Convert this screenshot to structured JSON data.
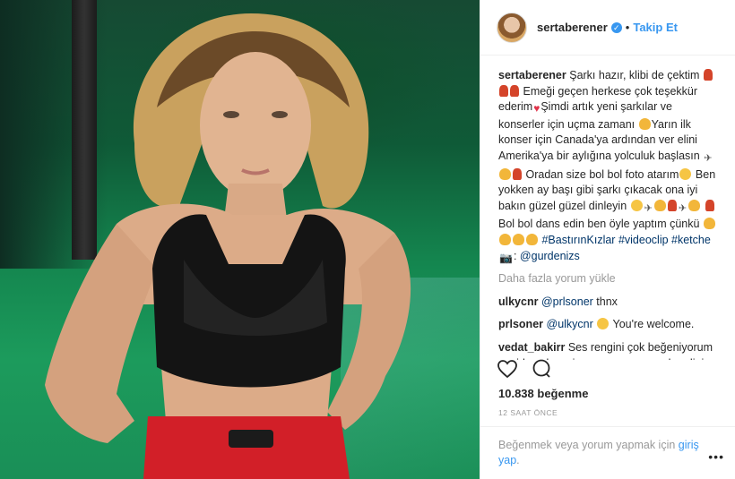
{
  "post": {
    "username": "sertaberener",
    "follow_label": "Takip Et",
    "separator": "•",
    "caption_parts": {
      "p1": "Şarkı hazır, klibi de çektim",
      "p2": "Emeği geçen herkese çok teşekkür ederim",
      "p3": "Şimdi artık yeni şarkılar ve konserler için uçma zamanı",
      "p4": "Yarın ilk konser için Canada'ya ardından ver elini Amerika'ya bir aylığına yolculuk başlasın",
      "p5": "Oradan size bol bol foto atarım",
      "p6": "Ben yokken ay başı gibi şarkı çıkacak ona iyi bakın güzel güzel dinleyin",
      "p7": "Bol bol dans edin ben öyle yaptım çünkü",
      "hashtag1": "#BastırınKızlar",
      "hashtag2": "#videoclip",
      "hashtag3": "#ketche",
      "colon": ":",
      "mention": "@gurdenizs"
    },
    "load_more": "Daha fazla yorum yükle",
    "comments": [
      {
        "user": "ulkycnr",
        "mention": "@prlsoner",
        "text": "thnx"
      },
      {
        "user": "prlsoner",
        "mention": "@ulkycnr",
        "text": "You're welcome."
      },
      {
        "user": "vedat_bakirr",
        "text": "Ses rengini çok beğeniyorum senide çok seviyorum ama yorma kendini öpüyorum kalbini"
      }
    ],
    "likes": "10.838 beğenme",
    "time": "12 SAAT ÖNCE",
    "footer_text": "Beğenmek veya yorum yapmak için",
    "login_text": "giriş yap",
    "footer_end": ".",
    "more_menu": "•••"
  },
  "icons": {
    "like": "heart-outline-icon",
    "comment": "speech-bubble-icon",
    "verified": "verified-badge-icon"
  },
  "colors": {
    "accent": "#3897f0",
    "text": "#262626",
    "muted": "#999999"
  }
}
